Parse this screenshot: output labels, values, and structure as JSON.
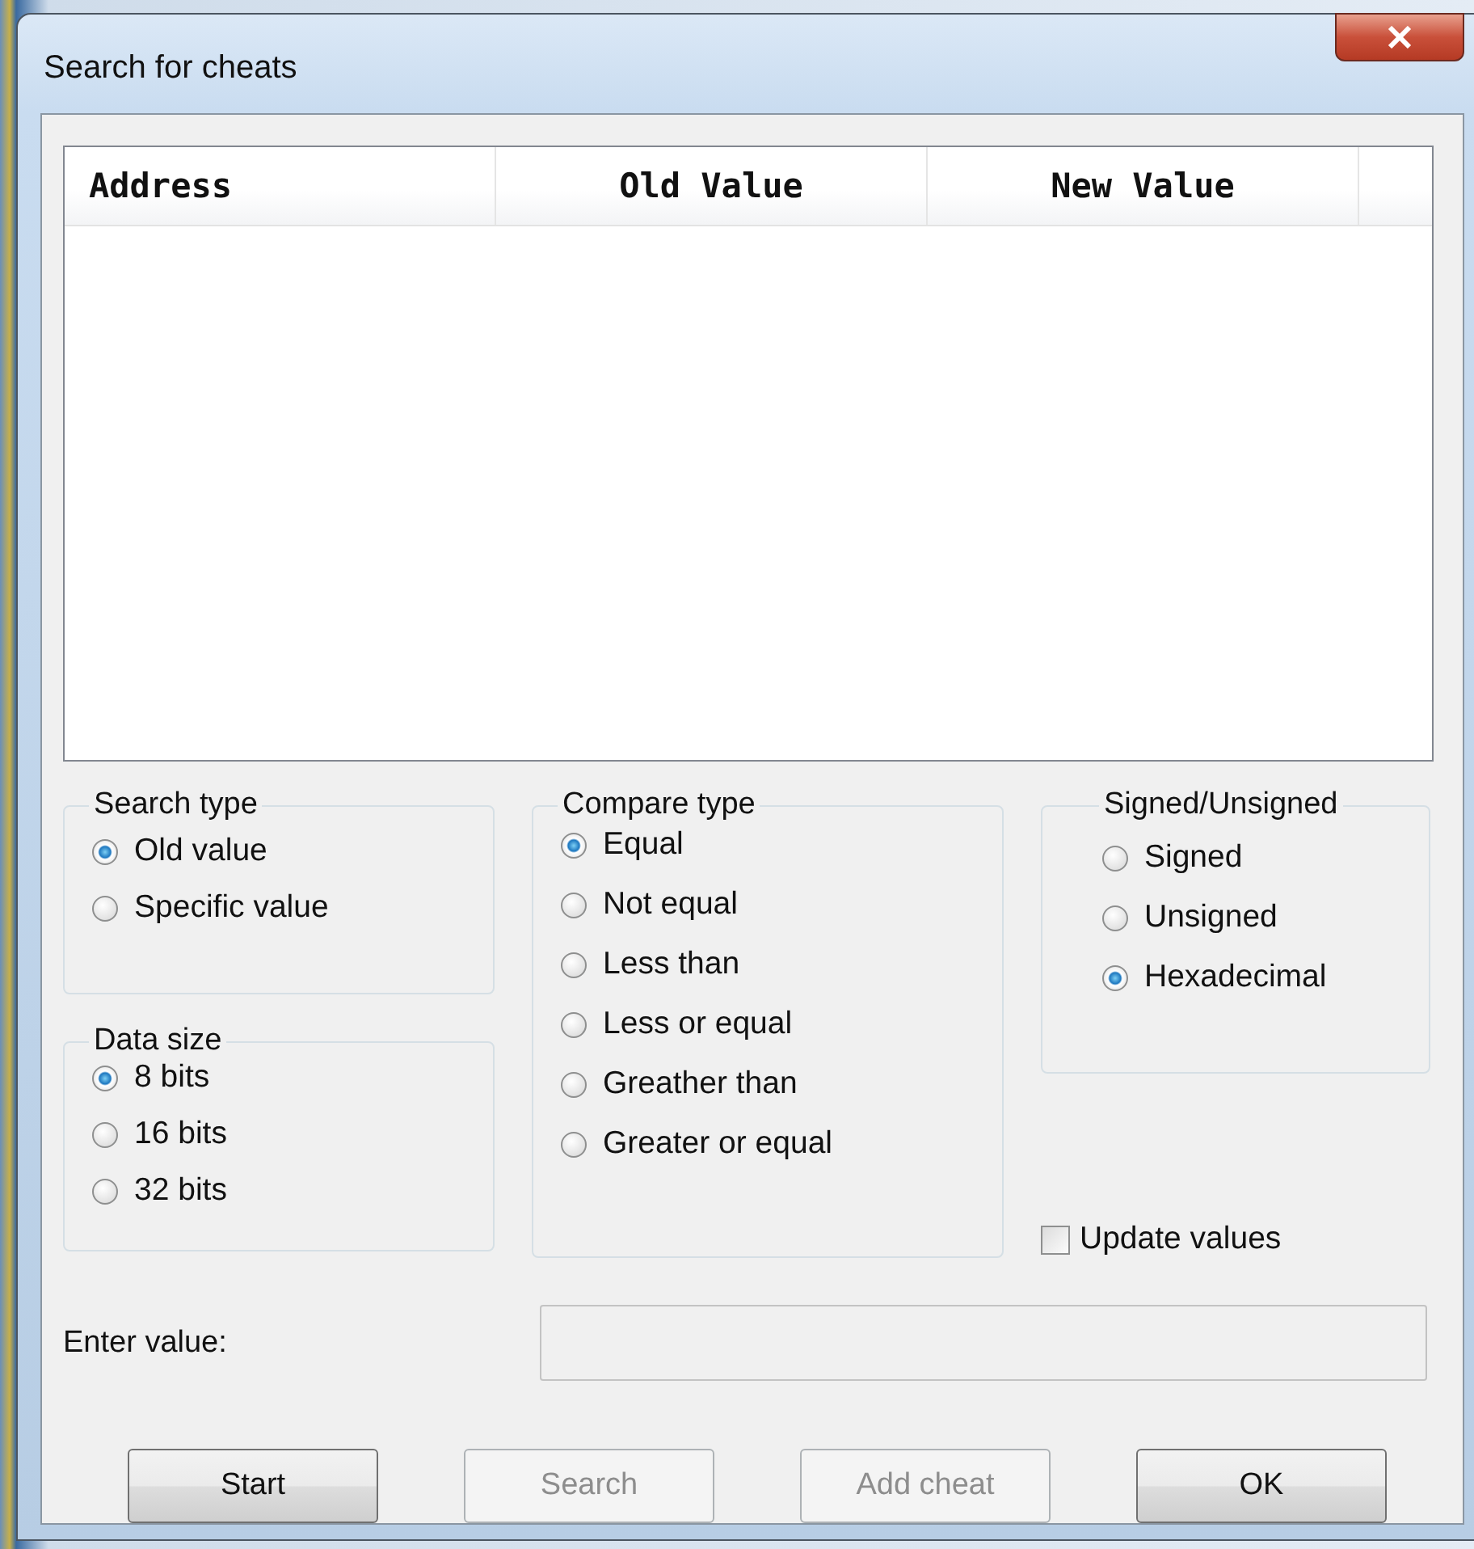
{
  "window": {
    "title": "Search for cheats"
  },
  "table": {
    "columns": [
      "Address",
      "Old Value",
      "New Value"
    ]
  },
  "search_type": {
    "label": "Search type",
    "options": [
      {
        "label": "Old value",
        "selected": true
      },
      {
        "label": "Specific value",
        "selected": false
      }
    ]
  },
  "data_size": {
    "label": "Data size",
    "options": [
      {
        "label": "8 bits",
        "selected": true
      },
      {
        "label": "16 bits",
        "selected": false
      },
      {
        "label": "32 bits",
        "selected": false
      }
    ]
  },
  "compare_type": {
    "label": "Compare type",
    "options": [
      {
        "label": "Equal",
        "selected": true
      },
      {
        "label": "Not equal",
        "selected": false
      },
      {
        "label": "Less than",
        "selected": false
      },
      {
        "label": "Less or equal",
        "selected": false
      },
      {
        "label": "Greather than",
        "selected": false
      },
      {
        "label": "Greater or equal",
        "selected": false
      }
    ]
  },
  "signed_unsigned": {
    "label": "Signed/Unsigned",
    "options": [
      {
        "label": "Signed",
        "selected": false
      },
      {
        "label": "Unsigned",
        "selected": false
      },
      {
        "label": "Hexadecimal",
        "selected": true
      }
    ]
  },
  "update_values": {
    "label": "Update values",
    "checked": false
  },
  "enter_value": {
    "label": "Enter value:",
    "disabled": true
  },
  "buttons": [
    {
      "label": "Start",
      "disabled": false
    },
    {
      "label": "Search",
      "disabled": true
    },
    {
      "label": "Add cheat",
      "disabled": true
    },
    {
      "label": "OK",
      "disabled": false
    }
  ]
}
